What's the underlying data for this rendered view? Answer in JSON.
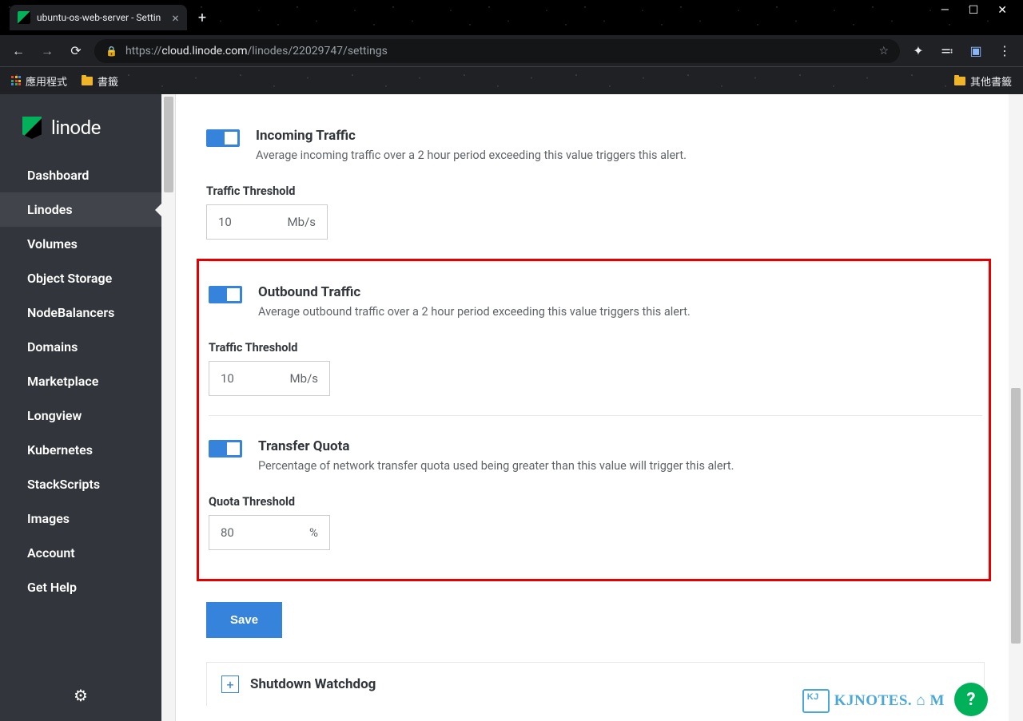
{
  "window": {
    "tab_title": "ubuntu-os-web-server - Settin"
  },
  "address": {
    "scheme": "https://",
    "domain": "cloud.linode.com",
    "path": "/linodes/22029747/settings"
  },
  "bookmarks": {
    "apps": "應用程式",
    "bm1": "書籤",
    "other": "其他書籤"
  },
  "brand": "linode",
  "sidebar": {
    "items": [
      {
        "label": "Dashboard"
      },
      {
        "label": "Linodes"
      },
      {
        "label": "Volumes"
      },
      {
        "label": "Object Storage"
      },
      {
        "label": "NodeBalancers"
      },
      {
        "label": "Domains"
      },
      {
        "label": "Marketplace"
      },
      {
        "label": "Longview"
      },
      {
        "label": "Kubernetes"
      },
      {
        "label": "StackScripts"
      },
      {
        "label": "Images"
      },
      {
        "label": "Account"
      },
      {
        "label": "Get Help"
      }
    ]
  },
  "alerts": {
    "incoming": {
      "title": "Incoming Traffic",
      "desc": "Average incoming traffic over a 2 hour period exceeding this value triggers this alert.",
      "threshold_label": "Traffic Threshold",
      "value": "10",
      "unit": "Mb/s"
    },
    "outbound": {
      "title": "Outbound Traffic",
      "desc": "Average outbound traffic over a 2 hour period exceeding this value triggers this alert.",
      "threshold_label": "Traffic Threshold",
      "value": "10",
      "unit": "Mb/s"
    },
    "quota": {
      "title": "Transfer Quota",
      "desc": "Percentage of network transfer quota used being greater than this value will trigger this alert.",
      "threshold_label": "Quota Threshold",
      "value": "80",
      "unit": "%"
    }
  },
  "buttons": {
    "save": "Save"
  },
  "accordion": {
    "shutdown": "Shutdown Watchdog"
  },
  "watermark": "KJNOTES. ⌂ M",
  "help": "?"
}
